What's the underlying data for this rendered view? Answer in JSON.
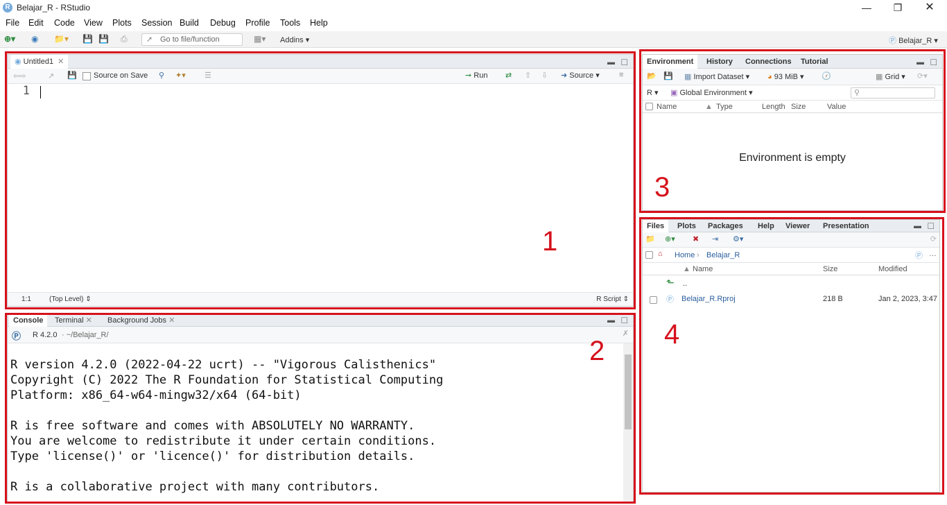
{
  "window": {
    "title": "Belajar_R - RStudio",
    "app_icon_letter": "R",
    "controls": [
      "minimize",
      "restore",
      "close"
    ]
  },
  "menu": [
    "File",
    "Edit",
    "Code",
    "View",
    "Plots",
    "Session",
    "Build",
    "Debug",
    "Profile",
    "Tools",
    "Help"
  ],
  "toolbar": {
    "goto_placeholder": "Go to file/function",
    "addins_label": "Addins",
    "project_label": "Belajar_R"
  },
  "editor": {
    "tab_label": "Untitled1",
    "source_on_save": "Source on Save",
    "run_label": "Run",
    "source_label": "Source",
    "line_number": "1",
    "status_position": "1:1",
    "status_scope": "(Top Level)",
    "status_filetype": "R Script"
  },
  "console": {
    "tabs": [
      "Console",
      "Terminal",
      "Background Jobs"
    ],
    "r_version": "R 4.2.0",
    "path": "· ~/Belajar_R/",
    "lines": [
      "R version 4.2.0 (2022-04-22 ucrt) -- \"Vigorous Calisthenics\"",
      "Copyright (C) 2022 The R Foundation for Statistical Computing",
      "Platform: x86_64-w64-mingw32/x64 (64-bit)",
      "",
      "R is free software and comes with ABSOLUTELY NO WARRANTY.",
      "You are welcome to redistribute it under certain conditions.",
      "Type 'license()' or 'licence()' for distribution details.",
      "",
      "R is a collaborative project with many contributors."
    ]
  },
  "environment": {
    "tabs": [
      "Environment",
      "History",
      "Connections",
      "Tutorial"
    ],
    "import_dataset": "Import Dataset",
    "memory": "93 MiB",
    "grid_label": "Grid",
    "language": "R",
    "scope": "Global Environment",
    "columns": [
      "Name",
      "Type",
      "Length",
      "Size",
      "Value"
    ],
    "empty_message": "Environment is empty"
  },
  "files": {
    "tabs": [
      "Files",
      "Plots",
      "Packages",
      "Help",
      "Viewer",
      "Presentation"
    ],
    "breadcrumb_home": "Home",
    "breadcrumb_folder": "Belajar_R",
    "columns": [
      "Name",
      "Size",
      "Modified"
    ],
    "parent_label": "..",
    "rows": [
      {
        "name": "Belajar_R.Rproj",
        "size": "218 B",
        "modified": "Jan 2, 2023, 3:47"
      }
    ]
  },
  "annotations": {
    "labels": [
      "1",
      "2",
      "3",
      "4"
    ],
    "color": "#d6111c"
  }
}
